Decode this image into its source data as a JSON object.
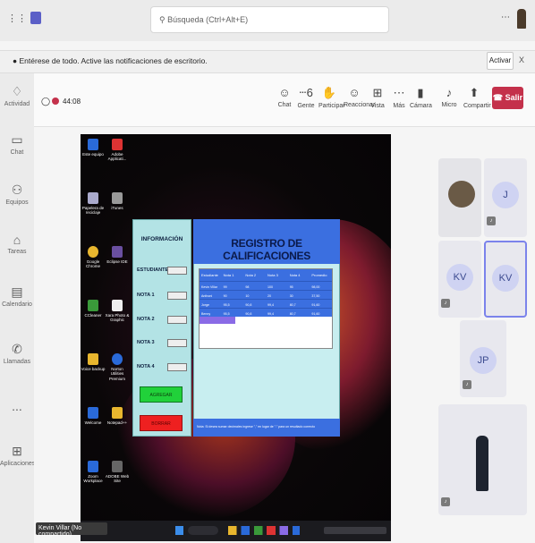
{
  "top": {
    "search_placeholder": "Búsqueda (Ctrl+Alt+E)"
  },
  "notice": {
    "text": "Entérese de todo. Active las notificaciones de escritorio.",
    "activate": "Activar",
    "close": "X"
  },
  "sidebar": {
    "items": [
      {
        "label": "Actividad",
        "icon": "bell-icon"
      },
      {
        "label": "Chat",
        "icon": "chat-icon"
      },
      {
        "label": "Equipos",
        "icon": "teams-icon"
      },
      {
        "label": "Tareas",
        "icon": "tasks-icon"
      },
      {
        "label": "Calendario",
        "icon": "calendar-icon"
      },
      {
        "label": "Llamadas",
        "icon": "phone-icon"
      },
      {
        "label": "...",
        "icon": "more-icon"
      },
      {
        "label": "Aplicaciones",
        "icon": "apps-icon"
      }
    ]
  },
  "call": {
    "timer": "44:08",
    "controls": [
      {
        "label": "Chat",
        "glyph": "☺"
      },
      {
        "label": "Gente",
        "glyph": "ⵈ6"
      },
      {
        "label": "Participar",
        "glyph": "✋"
      },
      {
        "label": "Reaccionar",
        "glyph": "☺"
      },
      {
        "label": "Vista",
        "glyph": "⊞"
      },
      {
        "label": "Más",
        "glyph": "⋯"
      },
      {
        "label": "Cámara",
        "glyph": "▮"
      },
      {
        "label": "Micro",
        "glyph": "♪"
      },
      {
        "label": "Compartir",
        "glyph": "⬆"
      }
    ],
    "leave": "Salir"
  },
  "app": {
    "info_title": "INFORMACIÓN",
    "title": "REGISTRO DE CALIFICACIONES",
    "fields": [
      "ESTUDIANTE",
      "NOTA 1",
      "NOTA 2",
      "NOTA 3",
      "NOTA 4"
    ],
    "add": "AGREGAR",
    "delete": "BORRAR",
    "columns": [
      "Estudiante",
      "Nota 1",
      "Nota 2",
      "Nota 3",
      "Nota 4",
      "Promedio"
    ],
    "rows": [
      [
        "Kevin Villar",
        "99",
        "98",
        "100",
        "95",
        "98,00"
      ],
      [
        "Anthoni",
        "90",
        "10",
        "20",
        "30",
        "37,50"
      ],
      [
        "Jorge",
        "95,5",
        "90,8",
        "99,4",
        "80,7",
        "91,60"
      ],
      [
        "Benny",
        "95,5",
        "90,8",
        "99,4",
        "80,7",
        "91,60"
      ]
    ],
    "note": "Nota: Si desea sumar decimales ingrese \",\" en lugar de \".\" para un resultado correcto"
  },
  "desktop_icons": [
    "Este equipo",
    "Adobe Applicati...",
    "Papelera de reciclaje",
    "iTunes",
    "Google Chrome",
    "Eclipse IDE",
    "CCleaner",
    "Xara Photo & Graphic",
    "Voice backup",
    "Norton Utilities Premium",
    "Welcome",
    "Notepad++",
    "Zoom Workplace",
    "ADOBE Web Site"
  ],
  "participants": [
    {
      "initials": "J"
    },
    {
      "initials": "KV"
    },
    {
      "initials": "KV"
    },
    {
      "initials": "JP"
    }
  ],
  "presenter_caption": "Kevin Villar (No compartido)"
}
